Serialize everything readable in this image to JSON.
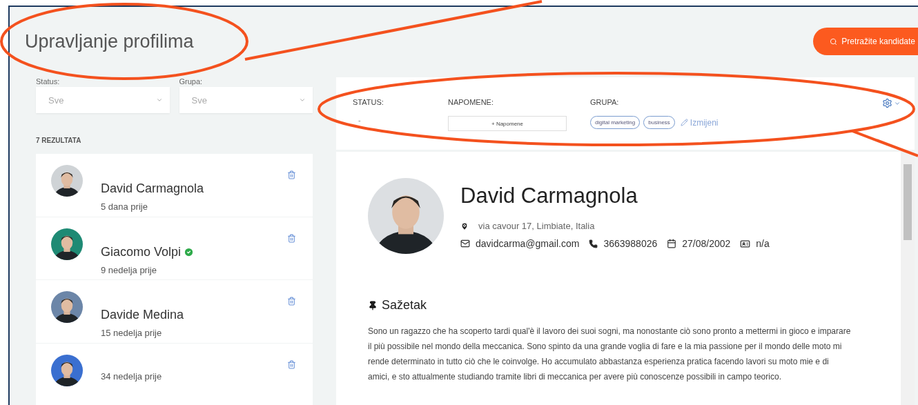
{
  "page": {
    "title": "Upravljanje profilima",
    "search_button": "Pretražite kandidate"
  },
  "filters": [
    {
      "label": "Status:",
      "value": "Sve"
    },
    {
      "label": "Grupa:",
      "value": "Sve"
    }
  ],
  "results_count": "7 REZULTATA",
  "candidates": [
    {
      "name": "David Carmagnola",
      "time": "5 dana prije",
      "verified": false
    },
    {
      "name": "Giacomo Volpi",
      "time": "9 nedelja prije",
      "verified": true
    },
    {
      "name": "Davide Medina",
      "time": "15 nedelja prije",
      "verified": false
    },
    {
      "time": "34 nedelja prije",
      "verified": false
    }
  ],
  "header": {
    "status_label": "STATUS:",
    "status_value": "-",
    "notes_label": "NAPOMENE:",
    "notes_button": "+ Napomene",
    "group_label": "GRUPA:",
    "groups": [
      "digital marketing",
      "business"
    ],
    "edit_link": "Izmijeni"
  },
  "profile": {
    "name": "David Carmagnola",
    "address": "via cavour 17, Limbiate, Italia",
    "email": "davidcarma@gmail.com",
    "phone": "3663988026",
    "birthdate": "27/08/2002",
    "id_value": "n/a"
  },
  "summary": {
    "heading": "Sažetak",
    "text": "Sono un ragazzo che ha scoperto tardi qual'è il lavoro dei suoi sogni, ma nonostante ciò sono pronto a mettermi in gioco e imparare il più possibile nel mondo della meccanica. Sono spinto da una grande voglia di fare e la mia passione per il mondo delle moto mi rende determinato in tutto ciò che le coinvolge. Ho accumulato abbastanza esperienza pratica facendo lavori su moto mie e di amici, e sto attualmente studiando tramite libri di meccanica per avere più conoscenze possibili in campo teorico."
  }
}
